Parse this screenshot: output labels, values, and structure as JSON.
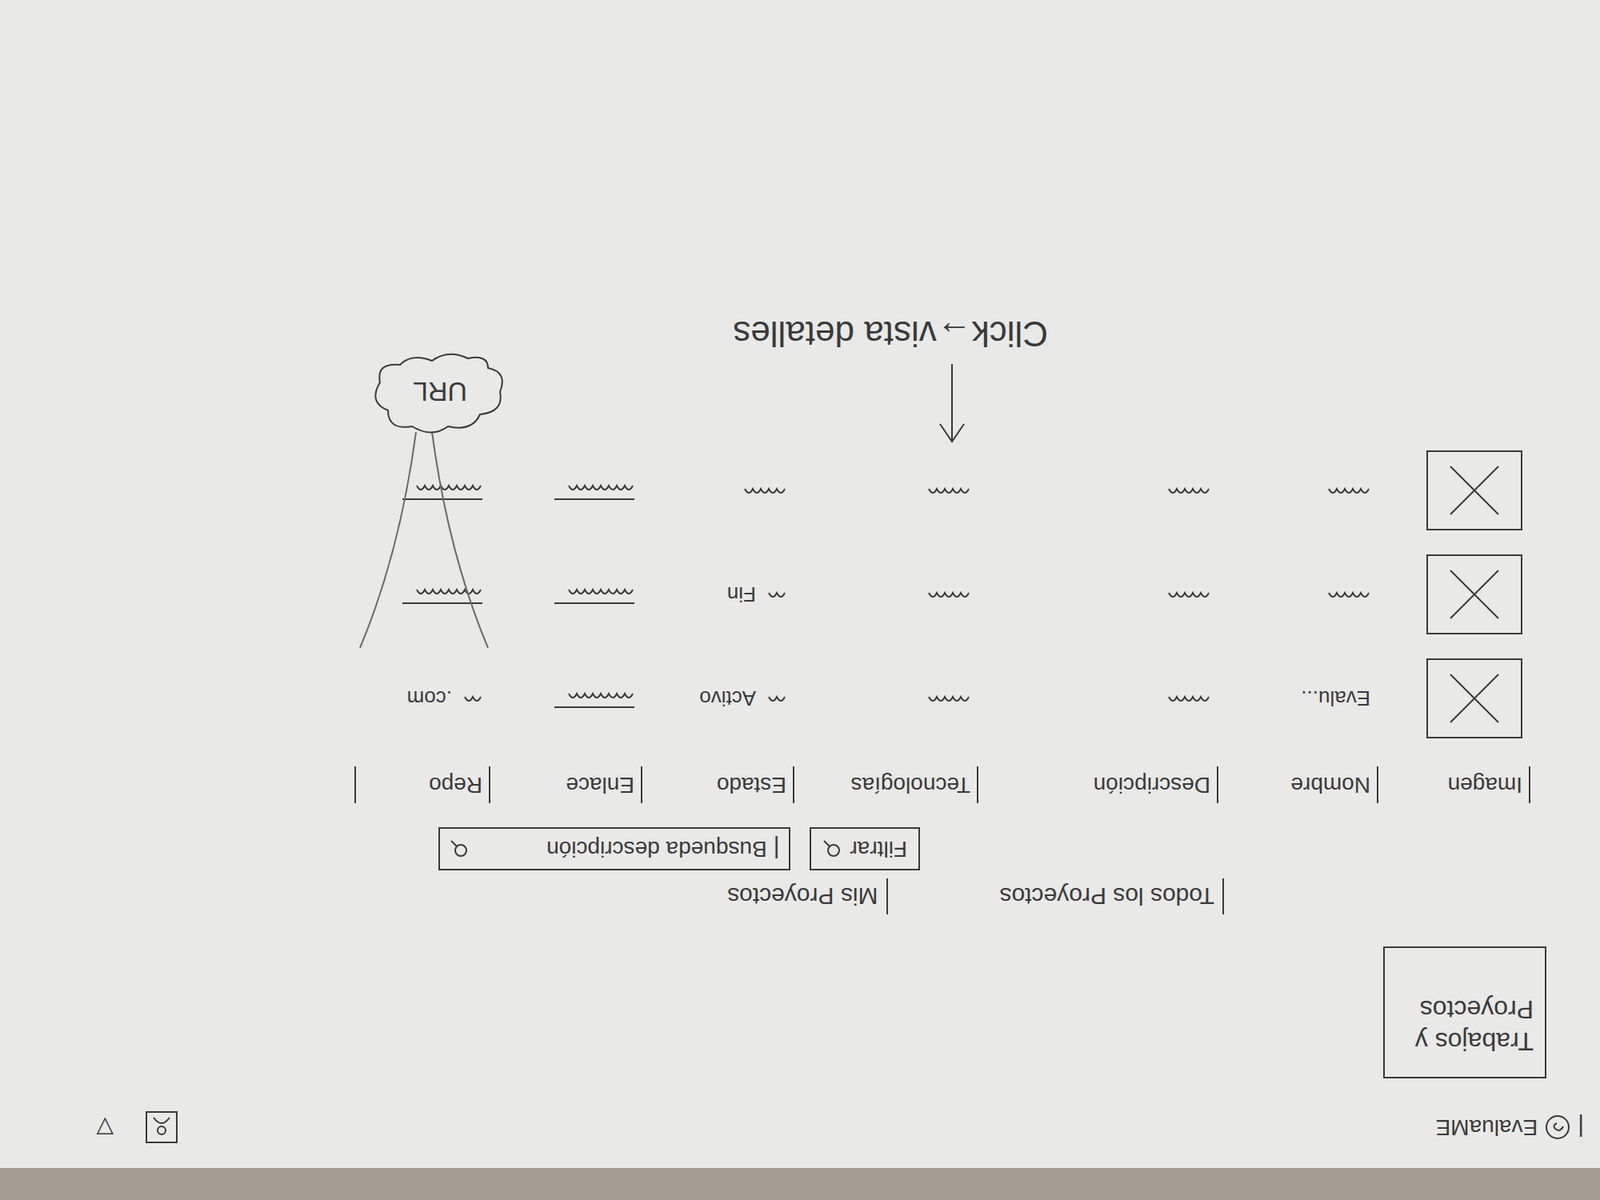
{
  "header": {
    "logo": "EvaluaME",
    "menu_arrow": "▽"
  },
  "nav": {
    "button": "Trabajos y Proyectos"
  },
  "tabs": [
    {
      "label": "Todos los Proyectos"
    },
    {
      "label": "Mis Proyectos"
    }
  ],
  "filters": {
    "filter_label": "Filtrar",
    "search_placeholder": "Busqueda descripción"
  },
  "table": {
    "columns": [
      "Imagen",
      "Nombre",
      "Descripción",
      "Tecnologías",
      "Estado",
      "Enlace",
      "Repo"
    ],
    "rows": [
      [
        {
          "kind": "image"
        },
        {
          "kind": "text",
          "text": "Evalu..."
        },
        {
          "kind": "scribble"
        },
        {
          "kind": "scribble"
        },
        {
          "kind": "scribble-text",
          "text": "Activo"
        },
        {
          "kind": "link"
        },
        {
          "kind": "scribble-text",
          "text": ".com"
        }
      ],
      [
        {
          "kind": "image"
        },
        {
          "kind": "scribble"
        },
        {
          "kind": "scribble"
        },
        {
          "kind": "scribble"
        },
        {
          "kind": "scribble-text",
          "text": "Fin"
        },
        {
          "kind": "link"
        },
        {
          "kind": "link"
        }
      ],
      [
        {
          "kind": "image"
        },
        {
          "kind": "scribble"
        },
        {
          "kind": "scribble"
        },
        {
          "kind": "scribble"
        },
        {
          "kind": "scribble"
        },
        {
          "kind": "link"
        },
        {
          "kind": "link"
        }
      ]
    ]
  },
  "annotations": {
    "url_note": "URL",
    "click_note": "Click→vista detalles"
  }
}
